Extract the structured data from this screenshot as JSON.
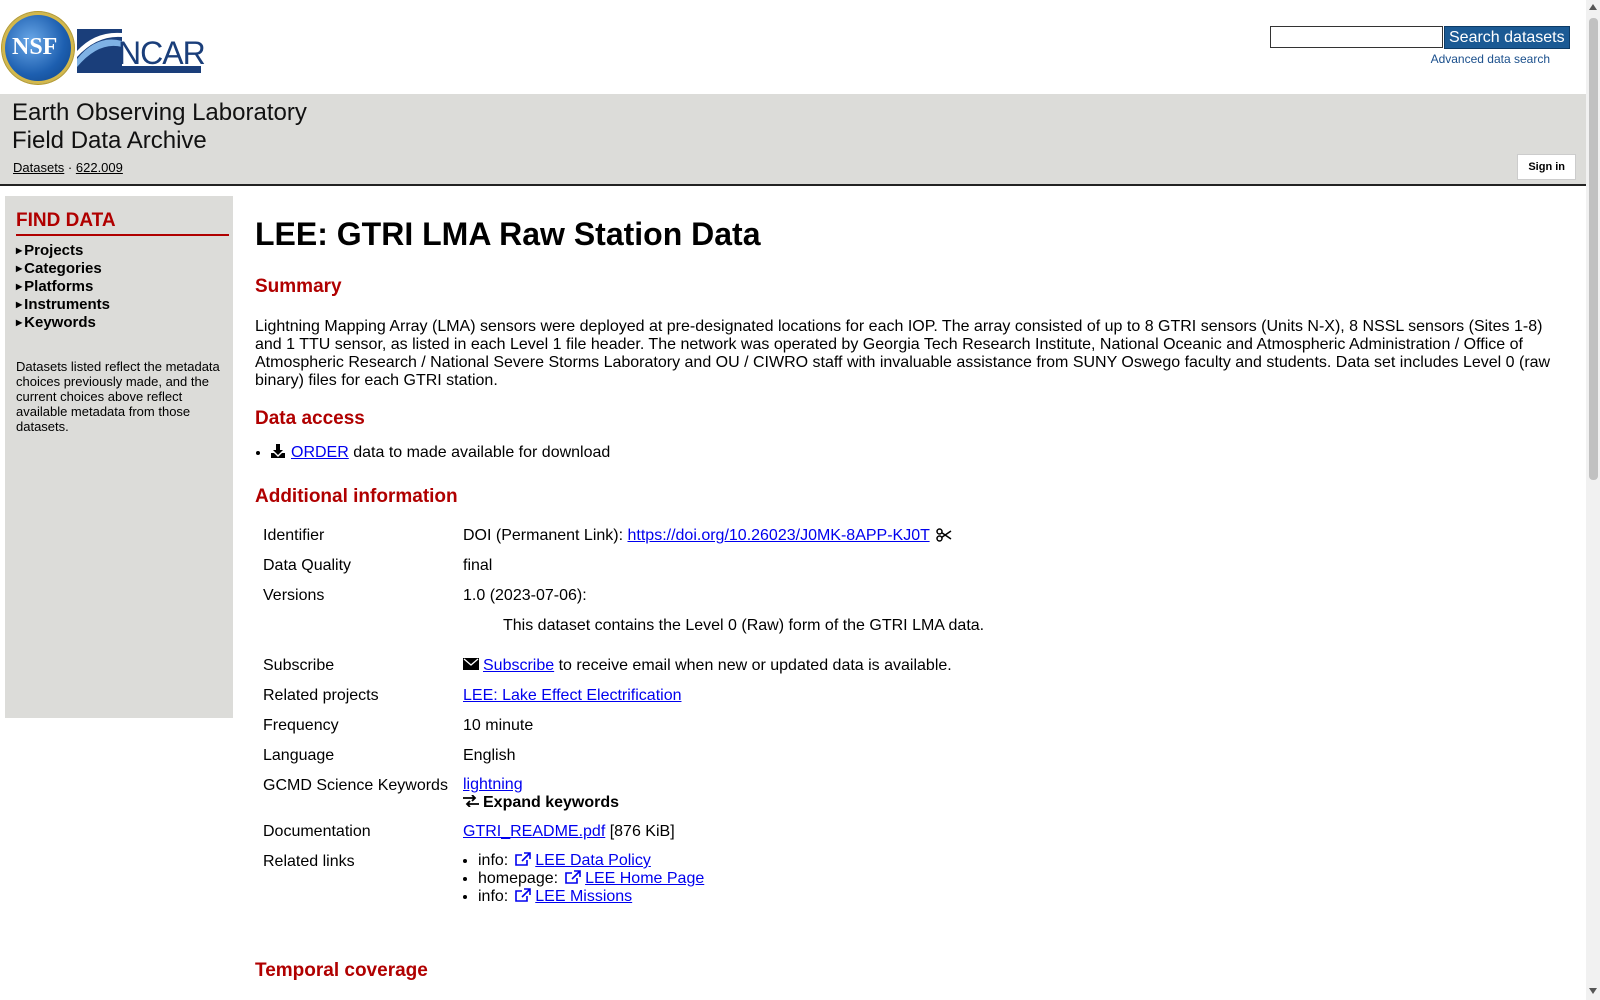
{
  "header": {
    "nsf_logo_text": "NSF",
    "ncar_logo_text": "NCAR",
    "search_placeholder": "",
    "search_button": "Search datasets",
    "advanced_search": "Advanced data search"
  },
  "banner": {
    "title_line1": "Earth Observing Laboratory",
    "title_line2": "Field Data Archive",
    "breadcrumb": {
      "datasets": "Datasets",
      "sep": " · ",
      "id": "622.009"
    },
    "sign_in": "Sign in"
  },
  "sidebar": {
    "title": "FIND DATA",
    "items": [
      "Projects",
      "Categories",
      "Platforms",
      "Instruments",
      "Keywords"
    ],
    "note": "Datasets listed reflect the metadata choices previously made, and the current choices above reflect available metadata from those datasets."
  },
  "main": {
    "title": "LEE: GTRI LMA Raw Station Data",
    "summary_heading": "Summary",
    "summary_text": "Lightning Mapping Array (LMA) sensors were deployed at pre-designated locations for each IOP. The array consisted of up to 8 GTRI sensors (Units N-X), 8 NSSL sensors (Sites 1-8) and 1 TTU sensor, as listed in each Level 1 file header. The network was operated by Georgia Tech Research Institute, National Oceanic and Atmospheric Administration / Office of Atmospheric Research / National Severe Storms Laboratory and OU / CIWRO staff with invaluable assistance from SUNY Oswego faculty and students. Data set includes Level 0 (raw binary) files for each GTRI station.",
    "access_heading": "Data access",
    "access_link": "ORDER",
    "access_text": " data to made available for download",
    "additional_heading": "Additional information",
    "temporal_heading": "Temporal coverage",
    "info": {
      "identifier_label": "Identifier",
      "identifier_prefix": "DOI (Permanent Link): ",
      "identifier_link": "https://doi.org/10.26023/J0MK-8APP-KJ0T",
      "quality_label": "Data Quality",
      "quality_value": "final",
      "versions_label": "Versions",
      "versions_value": "1.0 (2023-07-06):",
      "versions_note": "This dataset contains the Level 0 (Raw) form of the GTRI LMA data.",
      "subscribe_label": "Subscribe",
      "subscribe_link": "Subscribe",
      "subscribe_text": " to receive email when new or updated data is available.",
      "related_projects_label": "Related projects",
      "related_projects_link": "LEE: Lake Effect Electrification",
      "frequency_label": "Frequency",
      "frequency_value": "10 minute",
      "language_label": "Language",
      "language_value": "English",
      "gcmd_label": "GCMD Science Keywords",
      "gcmd_link": "lightning",
      "expand_keywords": "Expand keywords",
      "documentation_label": "Documentation",
      "documentation_link": "GTRI_README.pdf",
      "documentation_size": " [876 KiB]",
      "related_links_label": "Related links",
      "related_links": [
        {
          "type": "info:",
          "label": "LEE Data Policy"
        },
        {
          "type": "homepage:",
          "label": "LEE Home Page"
        },
        {
          "type": "info:",
          "label": "LEE Missions"
        }
      ]
    }
  },
  "icons": {
    "download": "download-icon",
    "copy": "scissors-icon",
    "mail": "envelope-icon",
    "swap": "exchange-icon",
    "external": "external-link-icon"
  },
  "colors": {
    "heading_red": "#b00000",
    "banner_gray": "#dcdcd9",
    "link_blue": "#0000ee",
    "search_button": "#1b5a94"
  }
}
